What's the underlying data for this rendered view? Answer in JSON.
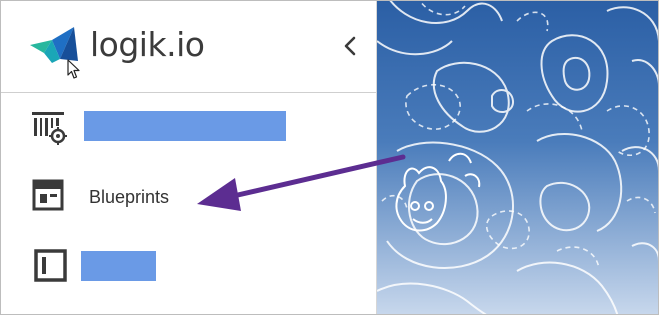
{
  "brand": {
    "name": "logik.io",
    "colors": {
      "blue": "#1f6fc4",
      "green": "#28b79e",
      "teal": "#1aa6b7"
    }
  },
  "header": {
    "collapse_icon": "chevron-left-icon"
  },
  "nav": {
    "items": [
      {
        "icon": "configurator-settings-icon",
        "label": "",
        "redacted": true
      },
      {
        "icon": "blueprint-layout-icon",
        "label": "Blueprints",
        "redacted": false
      },
      {
        "icon": "panel-sidebar-icon",
        "label": "",
        "redacted": true
      }
    ]
  },
  "annotation": {
    "arrow_color": "#5c2d91"
  },
  "colors": {
    "redaction": "#6a9ae6",
    "background_top": "#2e63a8",
    "background_bottom": "#c9d8ec",
    "text": "#333333"
  }
}
